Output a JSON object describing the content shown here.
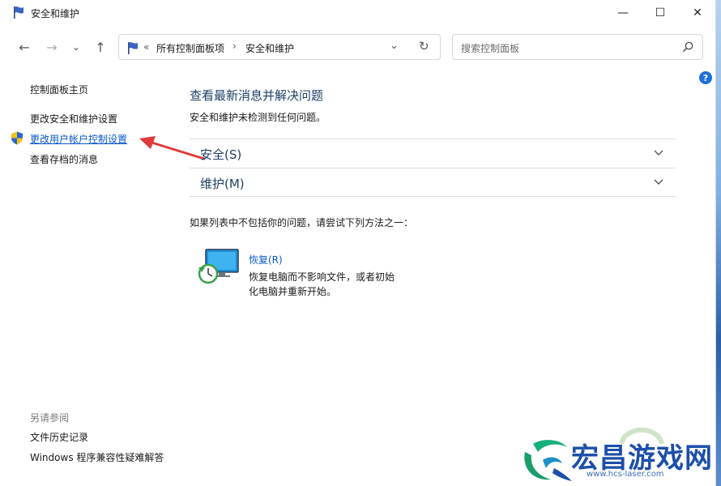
{
  "window": {
    "title": "安全和维护",
    "controls": {
      "minimize": "—",
      "maximize": "☐",
      "close": "✕"
    }
  },
  "nav": {
    "back": "←",
    "forward": "→",
    "recent": "⌄",
    "up": "↑"
  },
  "address": {
    "overflow": "«",
    "crumbs": [
      "所有控制面板项",
      "安全和维护"
    ],
    "separator": "›",
    "dropdown": "⌄",
    "refresh": "↻"
  },
  "search": {
    "placeholder": "搜索控制面板"
  },
  "help": {
    "label": "?"
  },
  "sidebar": {
    "items": [
      {
        "label": "控制面板主页"
      },
      {
        "label": "更改安全和维护设置"
      },
      {
        "label": "更改用户帐户控制设置"
      },
      {
        "label": "查看存档的消息"
      }
    ],
    "see_also": "另请参阅",
    "see_also_items": [
      {
        "label": "文件历史记录"
      },
      {
        "label": "Windows 程序兼容性疑难解答"
      }
    ]
  },
  "main": {
    "title": "查看最新消息并解决问题",
    "subtitle": "安全和维护未检测到任何问题。",
    "sections": [
      {
        "label": "安全(S)"
      },
      {
        "label": "维护(M)"
      }
    ],
    "hint": "如果列表中不包括你的问题，请尝试下列方法之一：",
    "recovery": {
      "link": "恢复(R)",
      "description": "恢复电脑而不影响文件，或者初始化电脑并重新开始。"
    }
  },
  "watermark": {
    "text": "宏昌游戏网",
    "url": "www.hcs-laser.com"
  },
  "colors": {
    "link": "#0a58c7",
    "heading": "#1e3f66",
    "arrow": "#e03a3a",
    "watermark": "#1c4fa8"
  }
}
